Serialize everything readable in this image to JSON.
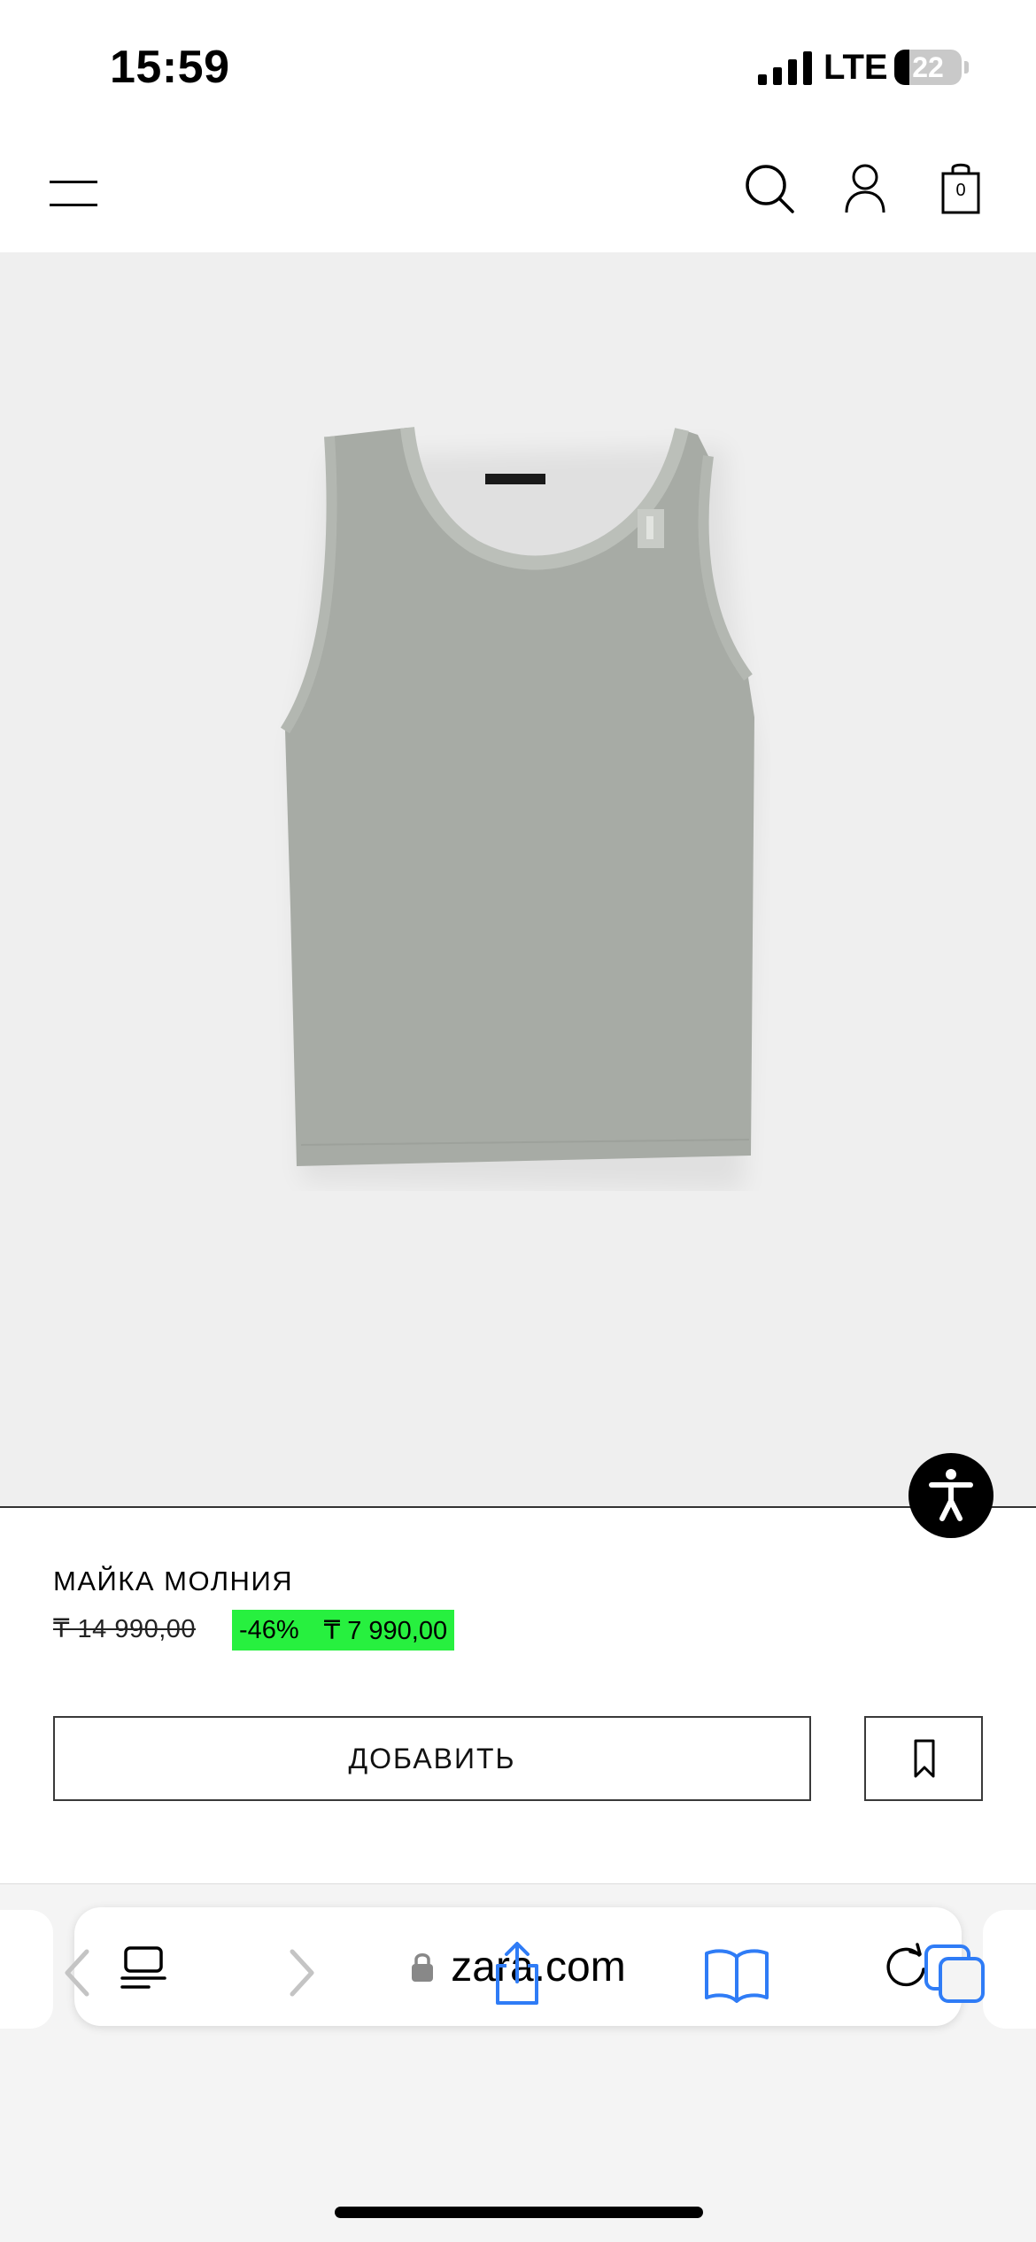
{
  "status_bar": {
    "time": "15:59",
    "network": "LTE",
    "battery_level": "22",
    "battery_fraction": 0.22
  },
  "header": {
    "menu_icon": "hamburger-icon",
    "search_icon": "search-icon",
    "account_icon": "user-icon",
    "cart_icon": "shopping-bag-icon",
    "cart_count": "0"
  },
  "product": {
    "image_subject": "tank-top",
    "image_color": "#a7aba5",
    "name": "МАЙКА МОЛНИЯ",
    "old_price": "₸ 14 990,00",
    "discount": "-46%",
    "new_price": "₸ 7 990,00",
    "sale_color": "#27f03f",
    "add_button": "ДОБАВИТЬ",
    "bookmark_icon": "bookmark-icon"
  },
  "accessibility": {
    "icon": "accessibility-icon"
  },
  "browser": {
    "url": "zara.com",
    "reader_icon": "page-menu-icon",
    "lock_icon": "lock-icon",
    "reload_icon": "reload-icon",
    "back_icon": "chevron-left-icon",
    "forward_icon": "chevron-right-icon",
    "share_icon": "share-icon",
    "bookmarks_icon": "book-icon",
    "tabs_icon": "tabs-icon",
    "accent_color": "#2f7cf6"
  }
}
